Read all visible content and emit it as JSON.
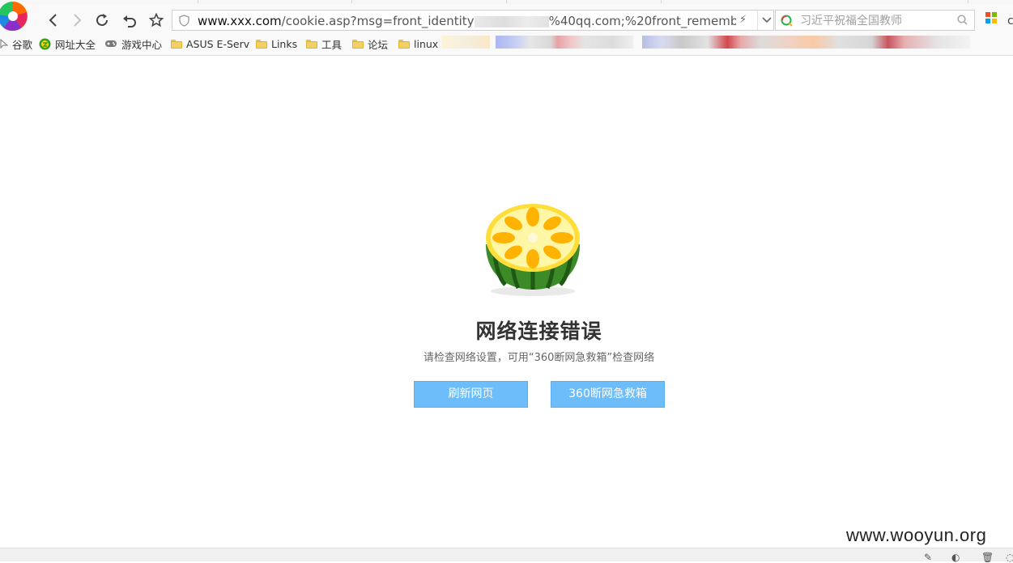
{
  "toolbar": {
    "url_host": "www.xxx.com",
    "url_path_start": "/cookie.asp?msg=front_identity",
    "url_path_end": "%40qq.com;%20front_remembe",
    "search_placeholder": "习近平祝福全国教师"
  },
  "bookmarks": [
    {
      "label": "谷歌",
      "icon": "google-icon"
    },
    {
      "label": "网址大全",
      "icon": "hao-icon"
    },
    {
      "label": "游戏中心",
      "icon": "gamepad-icon"
    },
    {
      "label": "ASUS E-Serv",
      "icon": "folder-icon"
    },
    {
      "label": "Links",
      "icon": "folder-icon"
    },
    {
      "label": "工具",
      "icon": "folder-icon"
    },
    {
      "label": "论坛",
      "icon": "folder-icon"
    },
    {
      "label": "linux",
      "icon": "folder-icon"
    }
  ],
  "error": {
    "title": "网络连接错误",
    "subtitle": "请检查网络设置，可用“360断网急救箱”检查网络",
    "refresh_button": "刷新网页",
    "rescue_button": "360断网急救箱"
  },
  "watermark": "www.wooyun.org",
  "colors": {
    "button_bg": "#6cbdfa",
    "title": "#333333"
  }
}
